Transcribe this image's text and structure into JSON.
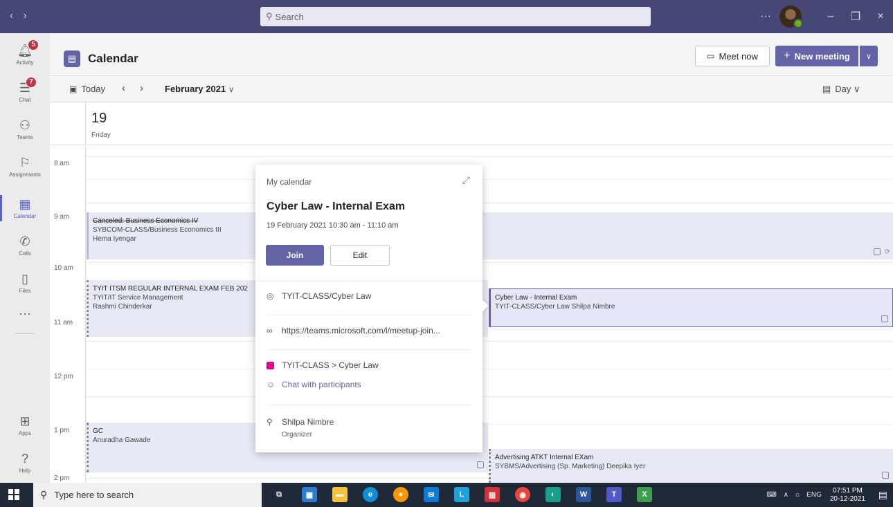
{
  "titlebar": {
    "search_placeholder": "Search",
    "more": "···",
    "minimize": "–",
    "maximize": "❐",
    "close": "×",
    "back": "‹",
    "forward": "›"
  },
  "rail": {
    "items": [
      {
        "label": "Activity",
        "icon": "bell-icon",
        "badge": "5"
      },
      {
        "label": "Chat",
        "icon": "chat-icon",
        "badge": "7"
      },
      {
        "label": "Teams",
        "icon": "teams-icon"
      },
      {
        "label": "Assignments",
        "icon": "assignments-icon"
      },
      {
        "label": "Calendar",
        "icon": "calendar-icon"
      },
      {
        "label": "Calls",
        "icon": "phone-icon"
      },
      {
        "label": "Files",
        "icon": "file-icon"
      },
      {
        "label": "Apps",
        "icon": "apps-icon"
      },
      {
        "label": "Help",
        "icon": "help-icon"
      }
    ],
    "more": "···"
  },
  "header": {
    "title": "Calendar",
    "meet_now": "Meet now",
    "new_meeting": "New meeting"
  },
  "toolbar": {
    "today": "Today",
    "month": "February 2021",
    "view": "Day"
  },
  "day": {
    "number": "19",
    "name": "Friday"
  },
  "times": [
    "8 am",
    "9 am",
    "10 am",
    "11 am",
    "12 pm",
    "1 pm",
    "2 pm"
  ],
  "events": {
    "bizecon": {
      "title": "Canceled: Business Economics IV",
      "line2": "SYBCOM-CLASS/Business Economics III",
      "line3": "Hema Iyengar"
    },
    "tyit": {
      "title": "TYIT ITSM REGULAR INTERNAL EXAM FEB 202",
      "line2": "TYIT/IT Service Management",
      "line3": "Rashmi Chinderkar"
    },
    "cyber": {
      "title": "Cyber Law - Internal Exam",
      "line2": "TYIT-CLASS/Cyber Law  Shilpa Nimbre"
    },
    "gc": {
      "title": "GC",
      "line2": "Anuradha Gawade"
    },
    "advertising": {
      "title": "Advertising ATKT Internal EXam",
      "line2": "SYBMS/Advertising (Sp. Marketing)  Deepika Iyer"
    }
  },
  "popup": {
    "calendar": "My calendar",
    "title": "Cyber Law - Internal Exam",
    "time": "19 February 2021 10:30 am - 11:10 am",
    "join": "Join",
    "edit": "Edit",
    "location": "TYIT-CLASS/Cyber Law",
    "link": "https://teams.microsoft.com/l/meetup-join...",
    "channel": "TYIT-CLASS > Cyber Law",
    "chat": "Chat with participants",
    "organizer": "Shilpa Nimbre",
    "organizer_role": "Organizer"
  },
  "taskbar": {
    "search": "Type here to search",
    "lang": "ENG",
    "time": "07:51 PM",
    "date": "20-12-2021"
  },
  "colors": {
    "accent": "#6264a7",
    "titlebar": "#464775",
    "badge": "#c4314b"
  }
}
